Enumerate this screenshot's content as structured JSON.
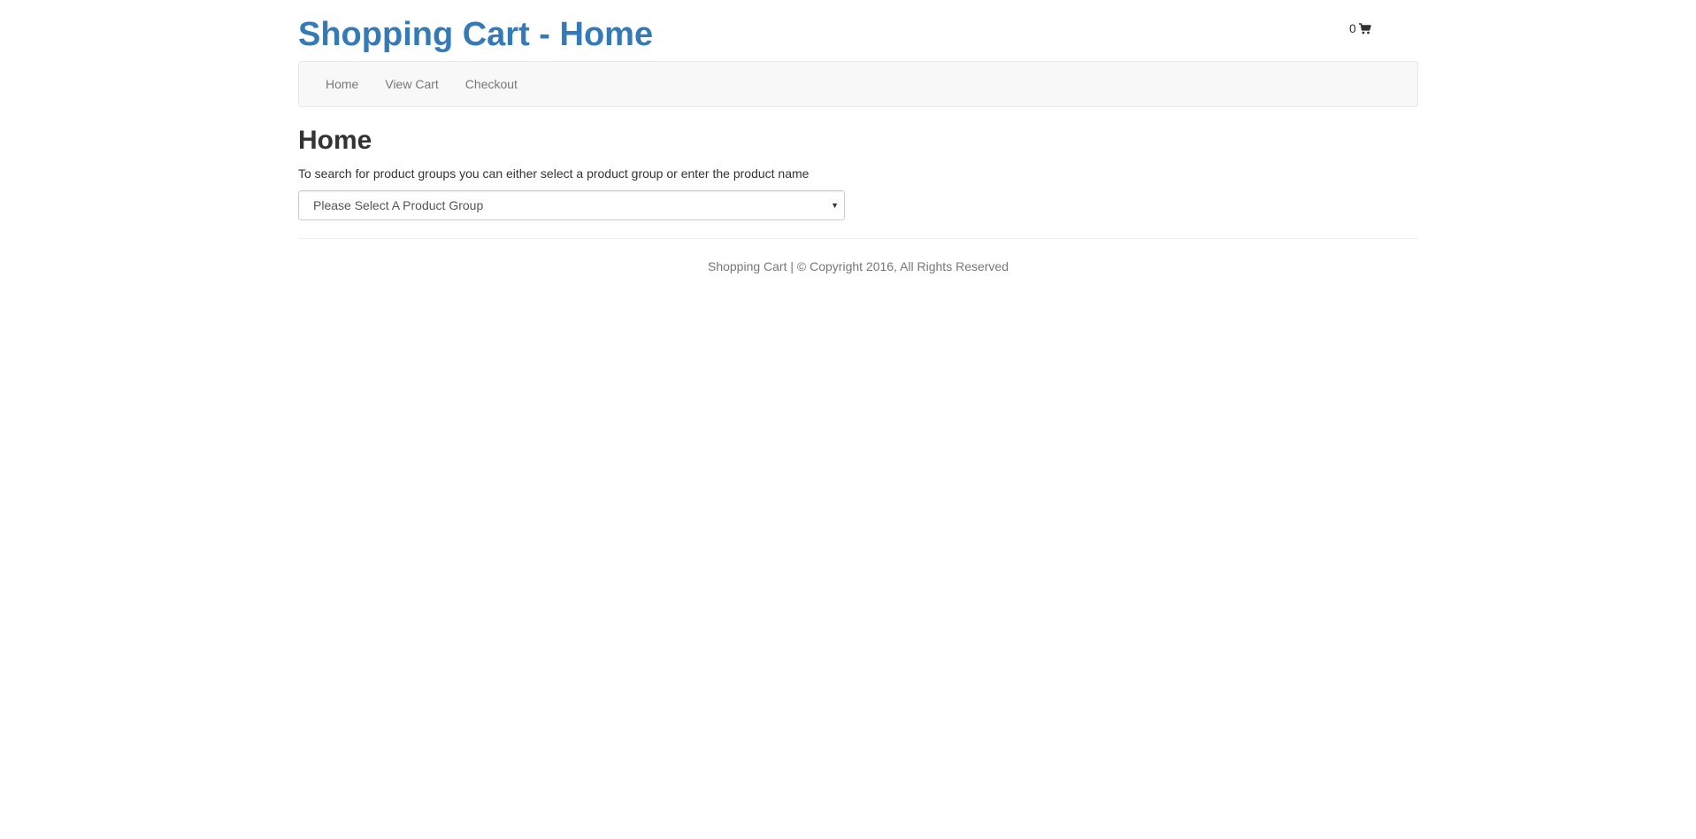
{
  "header": {
    "title": "Shopping Cart - Home",
    "cart_count": "0",
    "cart_icon": "shopping-cart-icon"
  },
  "nav": {
    "items": [
      {
        "label": "Home"
      },
      {
        "label": "View Cart"
      },
      {
        "label": "Checkout"
      }
    ]
  },
  "main": {
    "heading": "Home",
    "intro": "To search for product groups you can either select a product group or enter the product name",
    "product_group_select": {
      "selected": "Please Select A Product Group"
    }
  },
  "footer": {
    "text": "Shopping Cart | © Copyright 2016, All Rights Reserved"
  },
  "colors": {
    "brand": "#337ab7",
    "navbar_bg": "#f8f8f8",
    "nav_text": "#777777",
    "body_text": "#333333"
  }
}
